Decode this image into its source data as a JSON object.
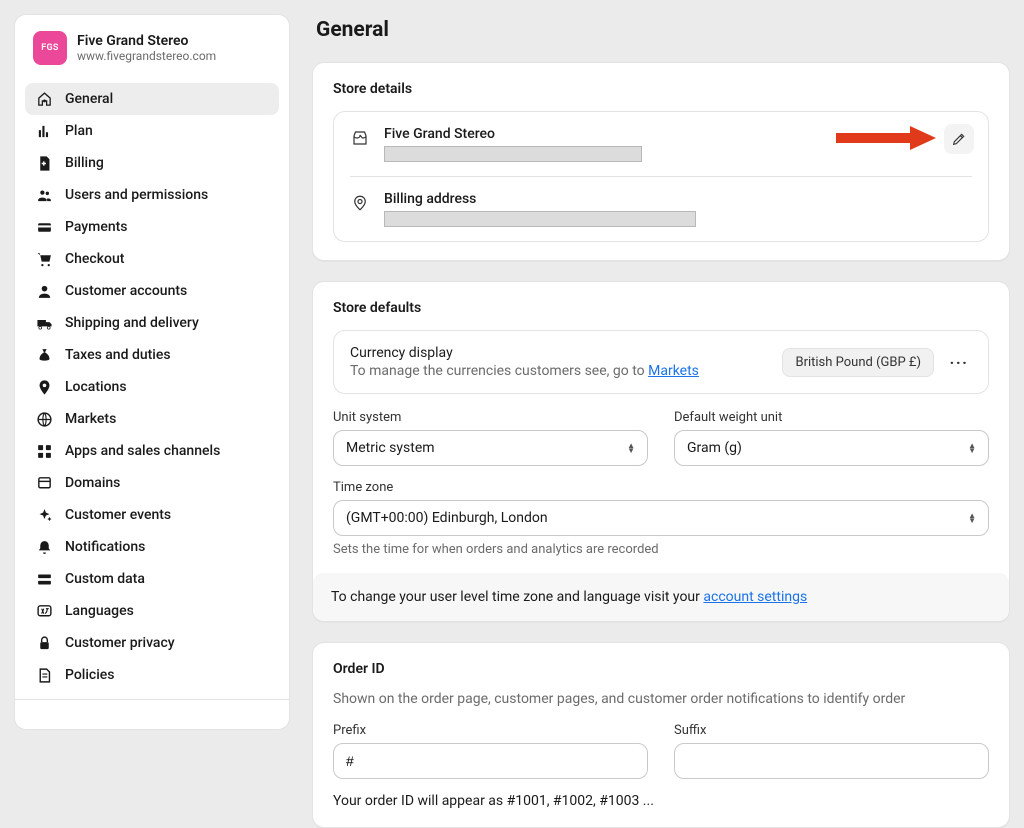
{
  "store": {
    "logo_text": "FGS",
    "name": "Five Grand Stereo",
    "url": "www.fivegrandstereo.com"
  },
  "sidebar": {
    "items": [
      {
        "label": "General"
      },
      {
        "label": "Plan"
      },
      {
        "label": "Billing"
      },
      {
        "label": "Users and permissions"
      },
      {
        "label": "Payments"
      },
      {
        "label": "Checkout"
      },
      {
        "label": "Customer accounts"
      },
      {
        "label": "Shipping and delivery"
      },
      {
        "label": "Taxes and duties"
      },
      {
        "label": "Locations"
      },
      {
        "label": "Markets"
      },
      {
        "label": "Apps and sales channels"
      },
      {
        "label": "Domains"
      },
      {
        "label": "Customer events"
      },
      {
        "label": "Notifications"
      },
      {
        "label": "Custom data"
      },
      {
        "label": "Languages"
      },
      {
        "label": "Customer privacy"
      },
      {
        "label": "Policies"
      }
    ]
  },
  "page": {
    "title": "General"
  },
  "store_details": {
    "heading": "Store details",
    "name_label": "Five Grand Stereo",
    "billing_label": "Billing address"
  },
  "defaults": {
    "heading": "Store defaults",
    "currency_title": "Currency display",
    "currency_sub_prefix": "To manage the currencies customers see, go to ",
    "currency_sub_link": "Markets",
    "currency_badge": "British Pound (GBP £)",
    "unit_system_label": "Unit system",
    "unit_system_value": "Metric system",
    "weight_label": "Default weight unit",
    "weight_value": "Gram (g)",
    "timezone_label": "Time zone",
    "timezone_value": "(GMT+00:00) Edinburgh, London",
    "timezone_help": "Sets the time for when orders and analytics are recorded",
    "account_note_prefix": "To change your user level time zone and language visit your ",
    "account_note_link": "account settings"
  },
  "order_id": {
    "heading": "Order ID",
    "sub": "Shown on the order page, customer pages, and customer order notifications to identify order",
    "prefix_label": "Prefix",
    "prefix_value": "#",
    "suffix_label": "Suffix",
    "suffix_value": "",
    "example": "Your order ID will appear as #1001, #1002, #1003 ..."
  }
}
